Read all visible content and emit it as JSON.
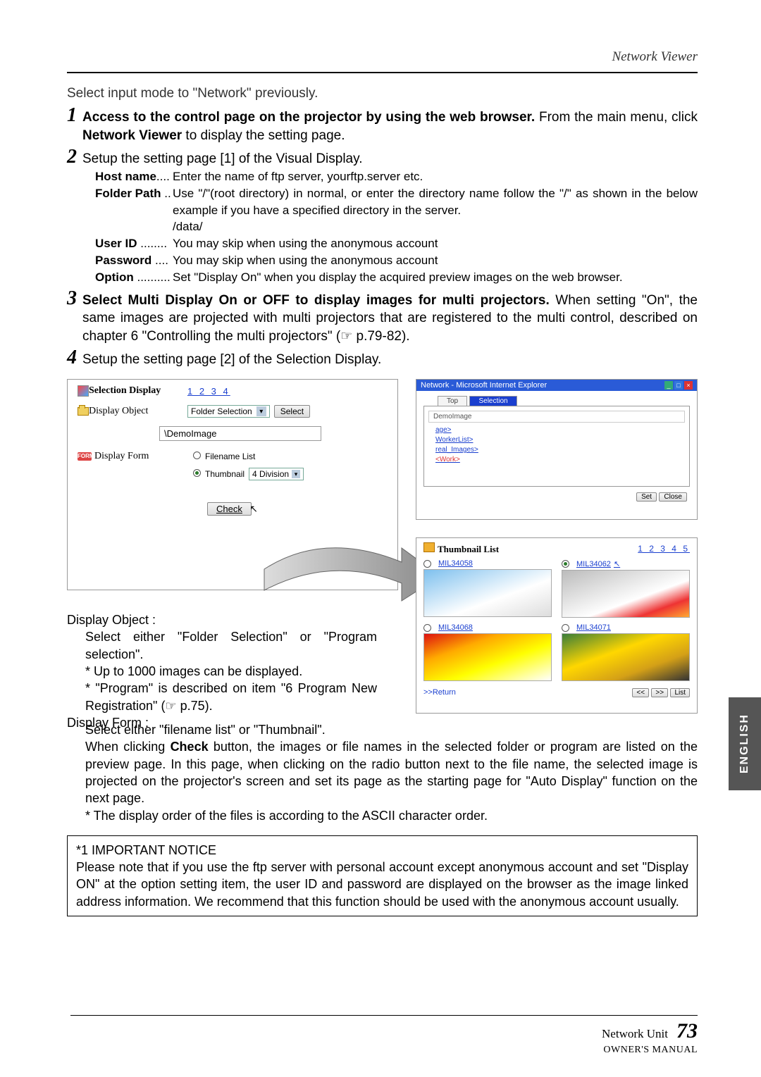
{
  "header": {
    "section": "Network  Viewer"
  },
  "intro": "Select input mode to \"Network\" previously.",
  "steps": {
    "s1": {
      "num": "1",
      "bold": "Access to the control page on the projector by using the web browser.",
      "rest": " From the main menu, click ",
      "bold2": "Network Viewer",
      "rest2": " to display the setting page."
    },
    "s2": {
      "num": "2",
      "text": "Setup the setting page [1] of the Visual Display.",
      "items": {
        "host_label": "Host name",
        "host_dots": "....",
        "host_desc": "Enter the name of ftp server, yourftp.server etc.",
        "folder_label": "Folder Path",
        "folder_dots": " ..",
        "folder_desc": "Use \"/\"(root directory) in normal, or enter the directory name follow the \"/\" as shown in the below example if you have a specified directory in the server.",
        "folder_extra": "/data/",
        "user_label": "User ID",
        "user_dots": " ........",
        "user_desc": "You may skip when using the anonymous account",
        "pass_label": "Password",
        "pass_dots": " ....",
        "pass_desc": "You may skip when using the anonymous account",
        "opt_label": "Option",
        "opt_dots": " ..........",
        "opt_desc": "Set \"Display On\" when you display the acquired preview images on the web browser."
      }
    },
    "s3": {
      "num": "3",
      "bold": "Select Multi Display On or OFF to display images for multi projectors.",
      "rest": " When setting \"On\", the same images are projected with multi projectors that are registered to the multi control, described on chapter 6 \"Controlling the multi projectors\" (☞ p.79-82)."
    },
    "s4": {
      "num": "4",
      "text": "Setup the setting page [2] of the Selection Display."
    }
  },
  "panel_left": {
    "sel_display": "Selection Display",
    "page_links": "1 2 3 4",
    "disp_object": "Display Object",
    "folder_sel": "Folder Selection",
    "select_btn": "Select",
    "path": "\\DemoImage",
    "disp_form": "Display Form",
    "form_badge": "FORM",
    "filename": "Filename List",
    "thumbnail": "Thumbnail",
    "division": "4 Division",
    "check": "Check"
  },
  "panel_right": {
    "title": "Network - Microsoft Internet Explorer",
    "tab1": "Top",
    "tab2": "Selection",
    "head": "DemoImage",
    "tree1": "age>",
    "tree2": "WorkerList>",
    "tree3": "real_Images>",
    "tree4": "<Work>",
    "set": "Set",
    "close": "Close"
  },
  "panel_thumb": {
    "title": "Thumbnail List",
    "page_links": "1 2 3 4 5",
    "c1": "MIL34058",
    "c2": "MIL34062",
    "c3": "MIL34068",
    "c4": "MIL34071",
    "return": ">>Return",
    "prev": "<<",
    "next": ">>",
    "list": "List"
  },
  "lower": {
    "do_head": "Display Object :",
    "do_body": "Select either \"Folder Selection\" or \"Program selection\".",
    "do_n1": "* Up to 1000 images can be displayed.",
    "do_n2": "* \"Program\" is described on item \"6 Program New Registration\" (☞ p.75).",
    "df_head": "Display Form :",
    "df_body": "Select either \"filename list\" or \"Thumbnail\".",
    "para": "When clicking ",
    "para_bold": "Check",
    "para2": " button, the images or file names in the selected folder or program are listed on the preview page. In this page, when clicking on the radio button next to the file name, the selected image is projected on the projector's screen and set its page as the starting page for \"Auto Display\" function on the next page.",
    "note": "* The display order of the files is according to the ASCII character order."
  },
  "notice": {
    "head": "*1 IMPORTANT NOTICE",
    "body": "Please note that if you use the ftp server with personal account except anonymous account and set \"Display ON\" at the option setting item, the user ID and password are displayed on the browser as the image linked address information. We recommend that this function should be used with the anonymous account usually."
  },
  "side": "ENGLISH",
  "footer": {
    "unit": "Network Unit",
    "page": "73",
    "manual": "OWNER'S MANUAL"
  }
}
